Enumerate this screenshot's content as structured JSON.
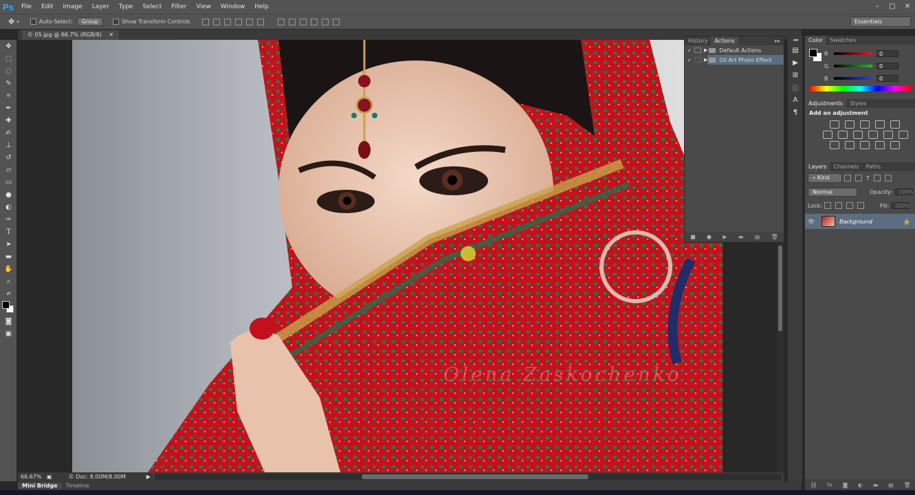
{
  "app": {
    "logo": "Ps"
  },
  "menu": [
    "File",
    "Edit",
    "Image",
    "Layer",
    "Type",
    "Select",
    "Filter",
    "View",
    "Window",
    "Help"
  ],
  "window_controls": [
    "–",
    "□",
    "✕"
  ],
  "options": {
    "auto_select_label": "Auto-Select:",
    "auto_select_value": "Group",
    "show_transform_label": "Show Transform Controls",
    "workspace": "Essentials"
  },
  "document": {
    "tab_title": "© 05.jpg @ 66.7% (RGB/8)",
    "zoom": "66.67%",
    "doc_size": "© Doc: 8.00M/8.00M",
    "watermark": "Olena Zaskochenko"
  },
  "actions_panel": {
    "tabs": [
      "History",
      "Actions"
    ],
    "active_tab": "Actions",
    "rows": [
      {
        "name": "Default Actions",
        "selected": false
      },
      {
        "name": "Oil Art Photo Effect",
        "selected": true
      }
    ]
  },
  "color_panel": {
    "tabs": [
      "Color",
      "Swatches"
    ],
    "channels": [
      {
        "label": "R",
        "value": "0",
        "color": "#d23030"
      },
      {
        "label": "G",
        "value": "0",
        "color": "#30b030"
      },
      {
        "label": "B",
        "value": "0",
        "color": "#3050e0"
      }
    ]
  },
  "adjustments_panel": {
    "tabs": [
      "Adjustments",
      "Styles"
    ],
    "heading": "Add an adjustment"
  },
  "layers_panel": {
    "tabs": [
      "Layers",
      "Channels",
      "Paths"
    ],
    "kind_label": "Kind",
    "blend_mode": "Normal",
    "opacity_label": "Opacity:",
    "opacity_value": "100%",
    "lock_label": "Lock:",
    "fill_label": "Fill:",
    "fill_value": "100%",
    "layers": [
      {
        "name": "Background",
        "visible": true,
        "locked": true
      }
    ]
  },
  "bottom_tabs": [
    "Mini Bridge",
    "Timeline"
  ]
}
